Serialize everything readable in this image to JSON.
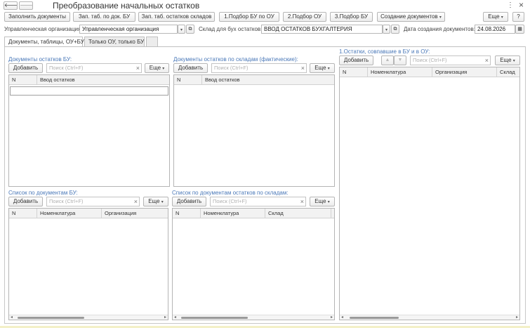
{
  "window": {
    "title": "Преобразование начальных остатков",
    "more_icon": "⋮",
    "close_icon": "×"
  },
  "toolbar": {
    "back_icon": "🡐",
    "forward_icon": "🡒",
    "fill_docs": "Заполнить документы",
    "fill_bu": "Зап. таб. по док. БУ",
    "fill_wh": "Зап. таб. остатков складов",
    "pick1": "1.Подбор БУ по ОУ",
    "pick2": "2.Подбор ОУ",
    "pick3": "3.Подбор БУ",
    "create_docs": "Создание документов",
    "more": "Еще",
    "help": "?"
  },
  "form": {
    "org_label": "Управленческая организация:",
    "org_value": "Управленческая организация",
    "wh_label": "Склад для бух остатков:",
    "wh_value": "ВВОД ОСТАТКОВ БУХГАЛТЕРИЯ",
    "date_label": "Дата создания документов:",
    "date_value": "24.08.2026"
  },
  "tabs": [
    "Документы, таблицы, ОУ+БУ",
    "Только ОУ, только БУ",
    ""
  ],
  "common": {
    "add": "Добавить",
    "search_placeholder": "Поиск (Ctrl+F)",
    "more": "Еще",
    "clear": "×",
    "arrow_dd": "▾"
  },
  "panels": {
    "docs_bu": {
      "title": "Документы остатков БУ:",
      "columns": [
        "N",
        "Ввод остатков"
      ]
    },
    "docs_wh": {
      "title": "Документы остатков по складам (фактические):",
      "columns": [
        "N",
        "Ввод остатков"
      ]
    },
    "match": {
      "title": "1.Остатки, совпавшие в БУ и в ОУ:",
      "up_icon": "▲",
      "down_icon": "▼",
      "columns": [
        "N",
        "Номенклатура",
        "Организация",
        "Склад"
      ]
    },
    "list_bu": {
      "title": "Список по документам БУ:",
      "columns": [
        "N",
        "Номенклатура",
        "Организация"
      ]
    },
    "list_wh": {
      "title": "Список по документам остатков по складам:",
      "columns": [
        "N",
        "Номенклатура",
        "Склад",
        ""
      ]
    }
  }
}
